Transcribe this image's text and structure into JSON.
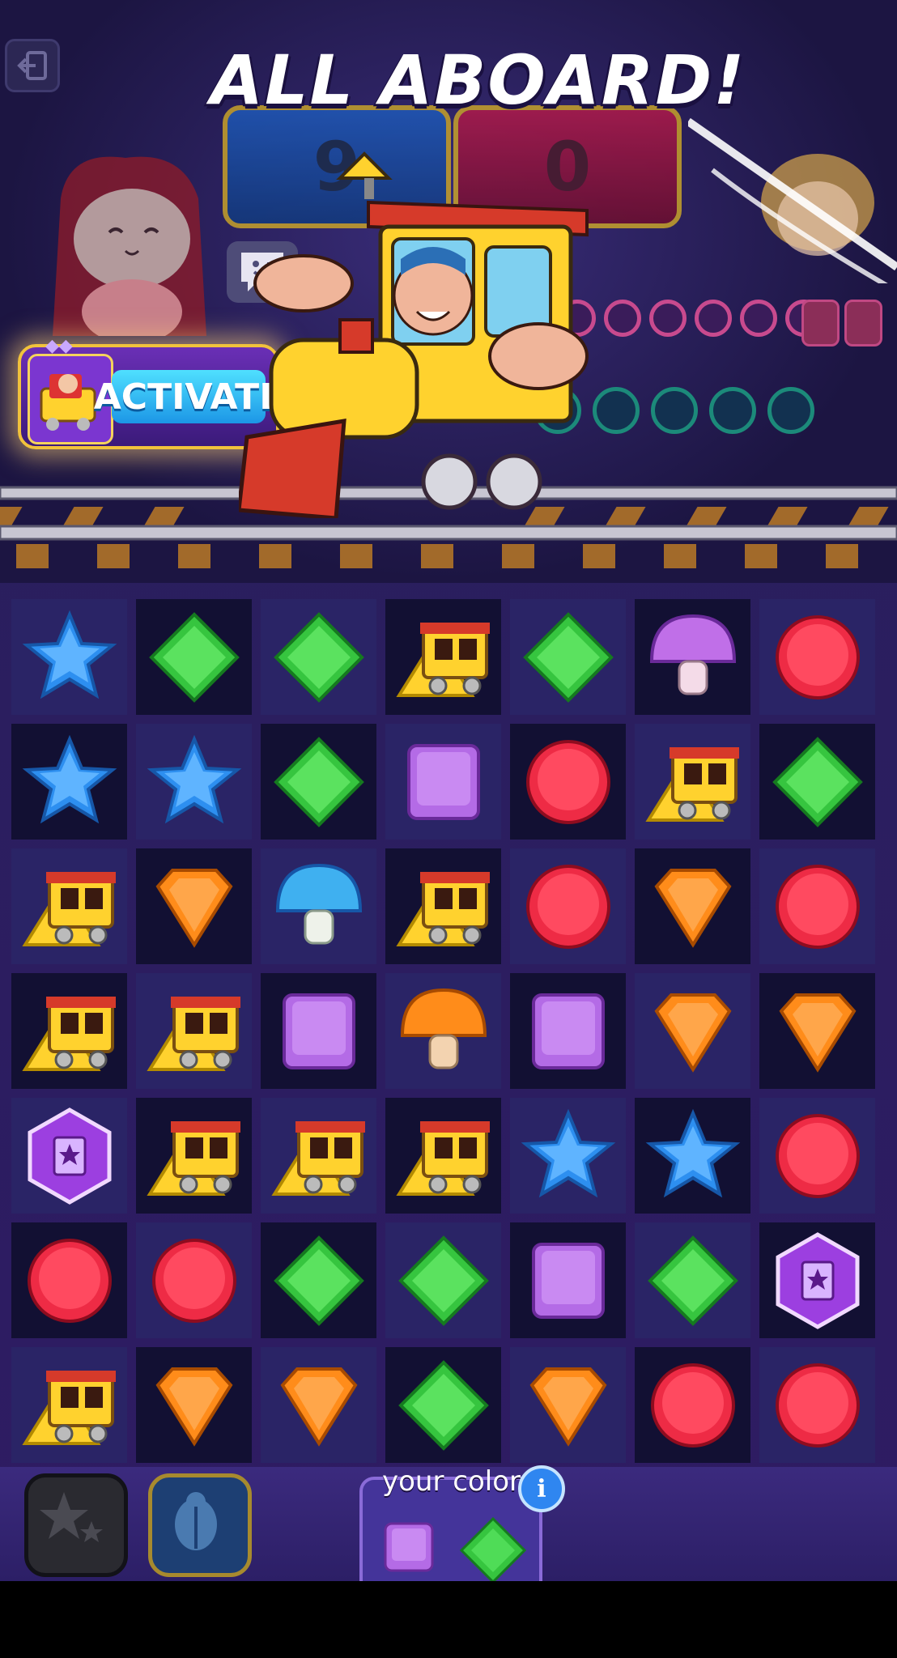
{
  "title_banner": "ALL ABOARD!",
  "scores": {
    "blue": "9",
    "red": "0"
  },
  "activate": {
    "label": "ACTIVATE"
  },
  "bottom": {
    "colors_label": "your colors",
    "info": "i",
    "your_colors": [
      "square-purple",
      "diamond-green"
    ]
  },
  "colors": {
    "blue": "#2d8ff0",
    "green": "#36c53f",
    "purple": "#b46be6",
    "red": "#ee2b45",
    "orange": "#ff8c1a",
    "yellow": "#ffd22e"
  },
  "board": {
    "rows": 7,
    "cols": 7,
    "pieces": [
      [
        "star-blue",
        "diamond-green",
        "diamond-green",
        "train",
        "diamond-green",
        "mushroom-purple",
        "circle-red"
      ],
      [
        "star-blue",
        "star-blue",
        "diamond-green",
        "square-purple",
        "circle-red",
        "train",
        "diamond-green"
      ],
      [
        "train",
        "shield-orange",
        "mushroom-blue",
        "train",
        "circle-red",
        "shield-orange",
        "circle-red"
      ],
      [
        "train",
        "train",
        "square-purple",
        "mushroom-orange",
        "square-purple",
        "shield-orange",
        "shield-orange"
      ],
      [
        "hex-book",
        "train",
        "train",
        "train",
        "star-blue",
        "star-blue",
        "circle-red"
      ],
      [
        "circle-red",
        "circle-red",
        "diamond-green",
        "diamond-green",
        "square-purple",
        "diamond-green",
        "hex-book"
      ],
      [
        "train",
        "shield-orange",
        "shield-orange",
        "diamond-green",
        "shield-orange",
        "circle-red",
        "circle-red"
      ]
    ]
  }
}
